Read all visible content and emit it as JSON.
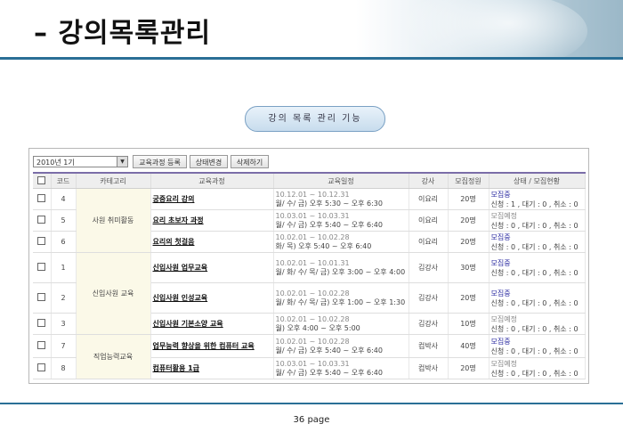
{
  "header": {
    "title": "– 강의목록관리"
  },
  "pill": {
    "label": "강의 목록 관리 기능"
  },
  "toolbar": {
    "semester": "2010년 1기",
    "register_label": "교육과정 등록",
    "status_change_label": "상태변경",
    "delete_label": "삭제하기"
  },
  "table": {
    "headers": [
      "코드",
      "카테고리",
      "교육과정",
      "교육일정",
      "강사",
      "모집정원",
      "상태 / 모집현황"
    ],
    "categories": [
      "사원 취미활동",
      "신입사원 교육",
      "직업능력교육"
    ],
    "rows": [
      {
        "code": "4",
        "course": "궁중요리 강의",
        "period": "10.12.01 ~ 10.12.31",
        "days": "월/ 수/ 금) 오후 5:30 ~ 오후 6:30",
        "teacher": "이요리",
        "capacity": "20명",
        "status": "모집중",
        "counts": "신청 : 1 , 대기 : 0 , 취소 : 0"
      },
      {
        "code": "5",
        "course": "요리 초보자 과정",
        "period": "10.03.01 ~ 10.03.31",
        "days": "월/ 수/ 금) 오후 5:40 ~ 오후 6:40",
        "teacher": "이요리",
        "capacity": "20명",
        "status": "모집예정",
        "counts": "신청 : 0 , 대기 : 0 , 취소 : 0"
      },
      {
        "code": "6",
        "course": "요리의 첫걸음",
        "period": "10.02.01 ~ 10.02.28",
        "days": "화/ 목) 오후 5:40 ~ 오후 6:40",
        "teacher": "이요리",
        "capacity": "20명",
        "status": "모집중",
        "counts": "신청 : 0 , 대기 : 0 , 취소 : 0"
      },
      {
        "code": "1",
        "course": "신입사원 업무교육",
        "period": "10.02.01 ~ 10.01.31",
        "days": "월/ 화/ 수/ 목/ 금) 오후 3:00 ~ 오후 4:00",
        "teacher": "김강사",
        "capacity": "30명",
        "status": "모집중",
        "counts": "신청 : 0 , 대기 : 0 , 취소 : 0"
      },
      {
        "code": "2",
        "course": "신입사원 인성교육",
        "period": "10.02.01 ~ 10.02.28",
        "days": "월/ 화/ 수/ 목/ 금) 오후 1:00 ~ 오후 1:30",
        "teacher": "김강사",
        "capacity": "20명",
        "status": "모집중",
        "counts": "신청 : 0 , 대기 : 0 , 취소 : 0"
      },
      {
        "code": "3",
        "course": "신입사원 기본소양 교육",
        "period": "10.02.01 ~ 10.02.28",
        "days": "월) 오후 4:00 ~ 오후 5:00",
        "teacher": "김강사",
        "capacity": "10명",
        "status": "모집예정",
        "counts": "신청 : 0 , 대기 : 0 , 취소 : 0"
      },
      {
        "code": "7",
        "course": "업무능력 향상을 위한 컴퓨터 교육",
        "period": "10.02.01 ~ 10.02.28",
        "days": "월/ 수/ 금) 오후 5:40 ~ 오후 6:40",
        "teacher": "컴박사",
        "capacity": "40명",
        "status": "모집중",
        "counts": "신청 : 0 , 대기 : 0 , 취소 : 0"
      },
      {
        "code": "8",
        "course": "컴퓨터활용 1급",
        "period": "10.03.01 ~ 10.03.31",
        "days": "월/ 수/ 금) 오후 5:40 ~ 오후 6:40",
        "teacher": "컴박사",
        "capacity": "20명",
        "status": "모집예정",
        "counts": "신청 : 0 , 대기 : 0 , 취소 : 0"
      }
    ]
  },
  "footer": {
    "page": "36 page"
  },
  "colors": {
    "accent": "#2a6f96",
    "header_rule": "#7b6da8",
    "status_active": "#2a2aa0"
  }
}
